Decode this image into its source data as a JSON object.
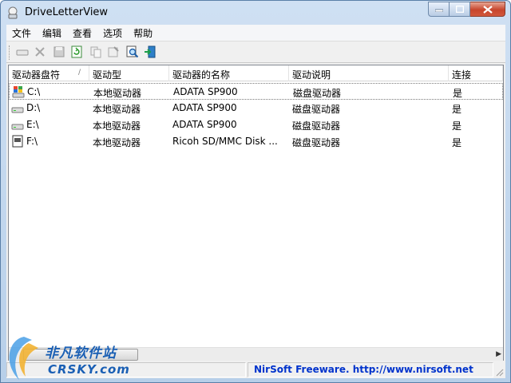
{
  "window": {
    "title": "DriveLetterView"
  },
  "menu": [
    "文件",
    "编辑",
    "查看",
    "选项",
    "帮助"
  ],
  "toolbar_icons": [
    "drive-icon",
    "delete-icon",
    "save-icon",
    "refresh-icon",
    "copy-icon",
    "properties-icon",
    "find-icon",
    "exit-icon"
  ],
  "columns": [
    "驱动器盘符",
    "驱动型",
    "驱动器的名称",
    "驱动说明",
    "连接"
  ],
  "rows": [
    {
      "icon": "windows-drive-icon",
      "letter": "C:\\",
      "type": "本地驱动器",
      "name": "ADATA SP900",
      "desc": "磁盘驱动器",
      "connected": "是"
    },
    {
      "icon": "hdd-icon",
      "letter": "D:\\",
      "type": "本地驱动器",
      "name": "ADATA SP900",
      "desc": "磁盘驱动器",
      "connected": "是"
    },
    {
      "icon": "hdd-icon",
      "letter": "E:\\",
      "type": "本地驱动器",
      "name": "ADATA SP900",
      "desc": "磁盘驱动器",
      "connected": "是"
    },
    {
      "icon": "card-reader-icon",
      "letter": "F:\\",
      "type": "本地驱动器",
      "name": "Ricoh SD/MMC Disk ...",
      "desc": "磁盘驱动器",
      "connected": "是"
    }
  ],
  "status": {
    "link": "NirSoft Freeware.  http://www.nirsoft.net"
  },
  "watermark": {
    "cn": "非凡软件站",
    "en": "CRSKY.com"
  }
}
